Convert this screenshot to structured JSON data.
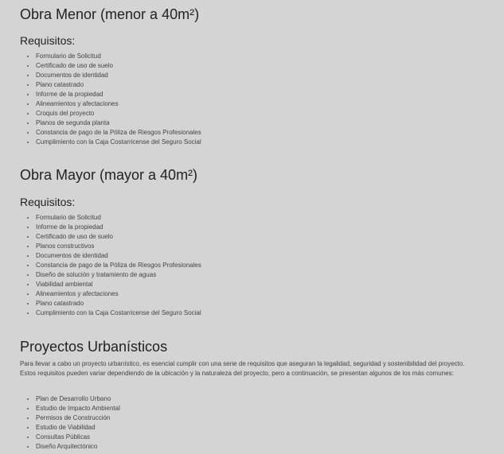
{
  "obra_menor": {
    "title": "Obra Menor (menor a 40m²)",
    "subtitle": "Requisitos:",
    "items": [
      "Formulario de Solicitud",
      "Certificado de uso de suelo",
      "Documentos de identidad",
      "Plano catastrado",
      "Informe de la propiedad",
      "Alineamientos y afectaciones",
      "Croquis del proyecto",
      "Planos de segunda planta",
      "Constancia de pago de la Póliza de Riesgos Profesionales",
      "Cumplimiento con la Caja Costarricense del Seguro Social"
    ]
  },
  "obra_mayor": {
    "title": "Obra Mayor (mayor a 40m²)",
    "subtitle": "Requisitos:",
    "items": [
      "Formulario de Solicitud",
      "Informe de la propiedad",
      "Certificado de uso de suelo",
      "Planos constructivos",
      "Documentos de identidad",
      "Constancia de pago de la Póliza de Riesgos Profesionales",
      "Diseño de solución y tratamiento de aguas",
      "Viabilidad ambiental",
      "Alineamientos y afectaciones",
      "Plano catastrado",
      "Cumplimiento con la Caja Costarricense del Seguro Social"
    ]
  },
  "proyectos_urbanisticos": {
    "title": "Proyectos Urbanísticos",
    "intro": "Para llevar a cabo un proyecto urbanístico, es esencial cumplir con una serie de requisitos que aseguran la legalidad, seguridad y sostenibilidad del proyecto. Estos requisitos pueden variar dependiendo de la ubicación y la naturaleza del proyecto, pero a continuación, se presentan algunos de los más comunes:",
    "items": [
      "Plan de Desarrollo Urbano",
      "Estudio de Impacto Ambiental",
      "Permisos de Construcción",
      "Estudio de Viabilidad",
      "Consultas Públicas",
      "Diseño Arquitectónico"
    ]
  }
}
